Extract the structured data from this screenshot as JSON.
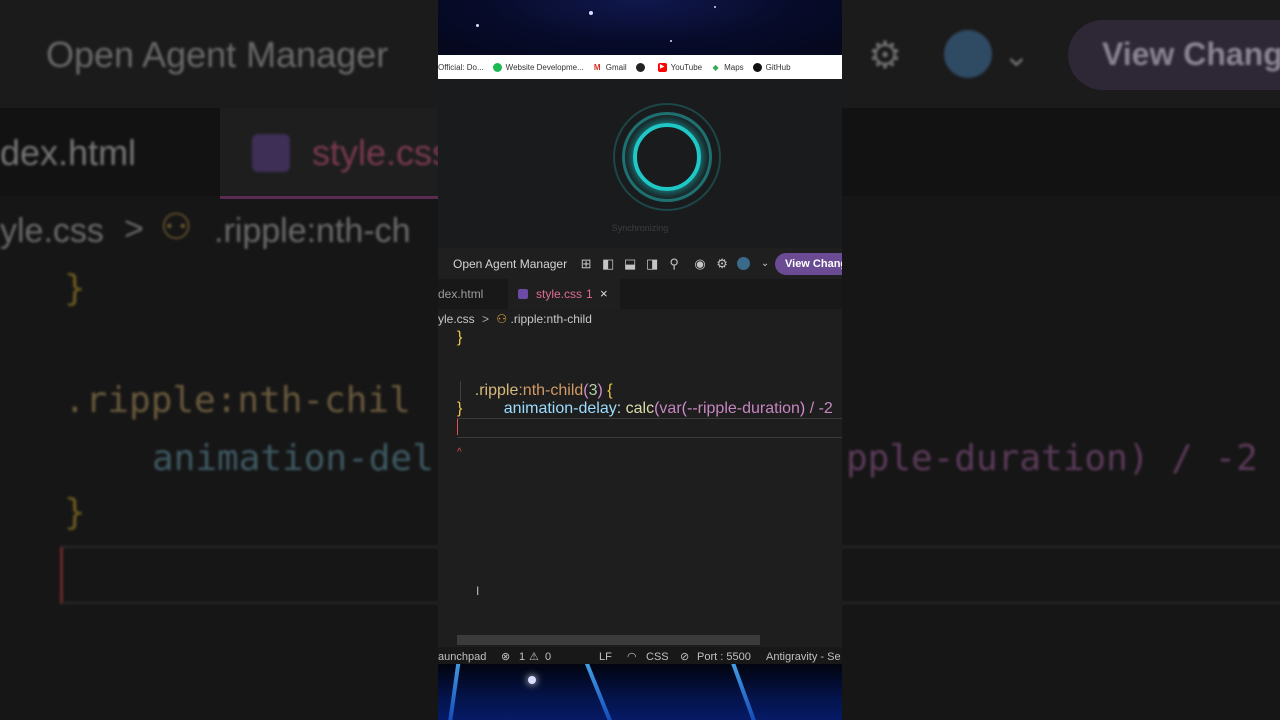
{
  "background": {
    "title": "Open Agent Manager",
    "view_changes": "View Changes",
    "tab_html": "dex.html",
    "tab_css": "style.css",
    "breadcrumb_file": "yle.css",
    "breadcrumb_symbol": ".ripple:nth-ch",
    "brace_top": "}",
    "selector": ".ripple:nth-chil",
    "property": "animation-del",
    "value_fragment": "pple-duration) / -2",
    "brace_bottom": "}"
  },
  "bookmarks": [
    {
      "label": "Official: Do...",
      "icon": "official-icon",
      "color": "#555555"
    },
    {
      "label": "Website Developme...",
      "icon": "website-icon",
      "color": "#1db954"
    },
    {
      "label": "Gmail",
      "icon": "gmail-icon",
      "color": "#d93025"
    },
    {
      "label": "",
      "icon": "globe-icon",
      "color": "#222222"
    },
    {
      "label": "YouTube",
      "icon": "youtube-icon",
      "color": "#ff0000"
    },
    {
      "label": "Maps",
      "icon": "maps-icon",
      "color": "#34a853"
    },
    {
      "label": "GitHub",
      "icon": "github-icon",
      "color": "#111111"
    }
  ],
  "preview": {
    "status_text": "Synchronizing"
  },
  "titlebar": {
    "title": "Open Agent Manager",
    "view_changes": "View Changes",
    "accent": "#6a4b94"
  },
  "tabs": [
    {
      "label": "dex.html",
      "active": false
    },
    {
      "label": "style.css",
      "count": "1",
      "close": "×",
      "active": true
    }
  ],
  "breadcrumb": {
    "file": "yle.css",
    "separator": ">",
    "symbol": ".ripple:nth-child"
  },
  "code": {
    "line1": "}",
    "selector": ".ripple",
    "pseudo": ":nth-child",
    "paren_open": "(",
    "arg": "3",
    "paren_close": ")",
    "brace_open": "{",
    "property": "animation-delay",
    "colon": ":",
    "fn": "calc",
    "var_fn": "var",
    "var_name": "--ripple-duration",
    "operator": "/ -2",
    "brace_close": "}",
    "error_marker": "^"
  },
  "statusbar": {
    "launchpad": "aunchpad",
    "errors": "1",
    "warnings": "0",
    "eol": "LF",
    "language": "CSS",
    "port": "Port : 5500",
    "extension": "Antigravity - Se"
  }
}
